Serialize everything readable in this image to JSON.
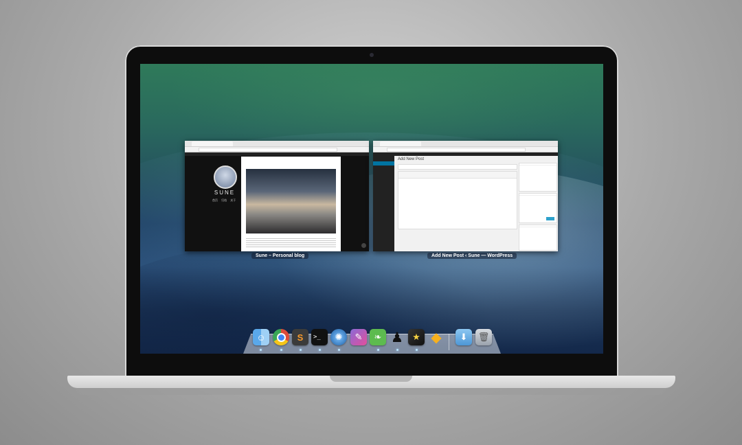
{
  "windows": [
    {
      "label": "Sune – Personal blog"
    },
    {
      "label": "Add New Post ‹ Sune — WordPress"
    }
  ],
  "blog": {
    "brand": "SUNE",
    "nav": [
      "首页",
      "归档",
      "关于"
    ]
  },
  "wordpress": {
    "heading": "Add New Post"
  },
  "dock": {
    "apps": [
      {
        "name": "finder",
        "icon": "finder-icon",
        "color": "#4a90e2"
      },
      {
        "name": "chrome",
        "icon": "chrome-icon",
        "color": "#d93f31"
      },
      {
        "name": "sublime-text",
        "icon": "sublime-text-icon",
        "color": "#3b3b3b"
      },
      {
        "name": "terminal",
        "icon": "terminal-icon",
        "color": "#1a1a1a"
      },
      {
        "name": "network-utility",
        "icon": "network-utility-icon",
        "color": "#2a6db0"
      },
      {
        "name": "texture",
        "icon": "texture-icon",
        "color": "#7a5cc2"
      },
      {
        "name": "evernote",
        "icon": "evernote-icon",
        "color": "#3fa63b"
      },
      {
        "name": "qq",
        "icon": "qq-icon",
        "color": "#111111"
      },
      {
        "name": "photo-app",
        "icon": "photo-app-icon",
        "color": "#222222"
      },
      {
        "name": "sketch",
        "icon": "sketch-icon",
        "color": "#f6b01e"
      },
      {
        "name": "downloads",
        "icon": "downloads-folder-icon",
        "color": "#6fb4ea"
      },
      {
        "name": "trash",
        "icon": "trash-icon",
        "color": "#9aa2ad"
      }
    ]
  }
}
